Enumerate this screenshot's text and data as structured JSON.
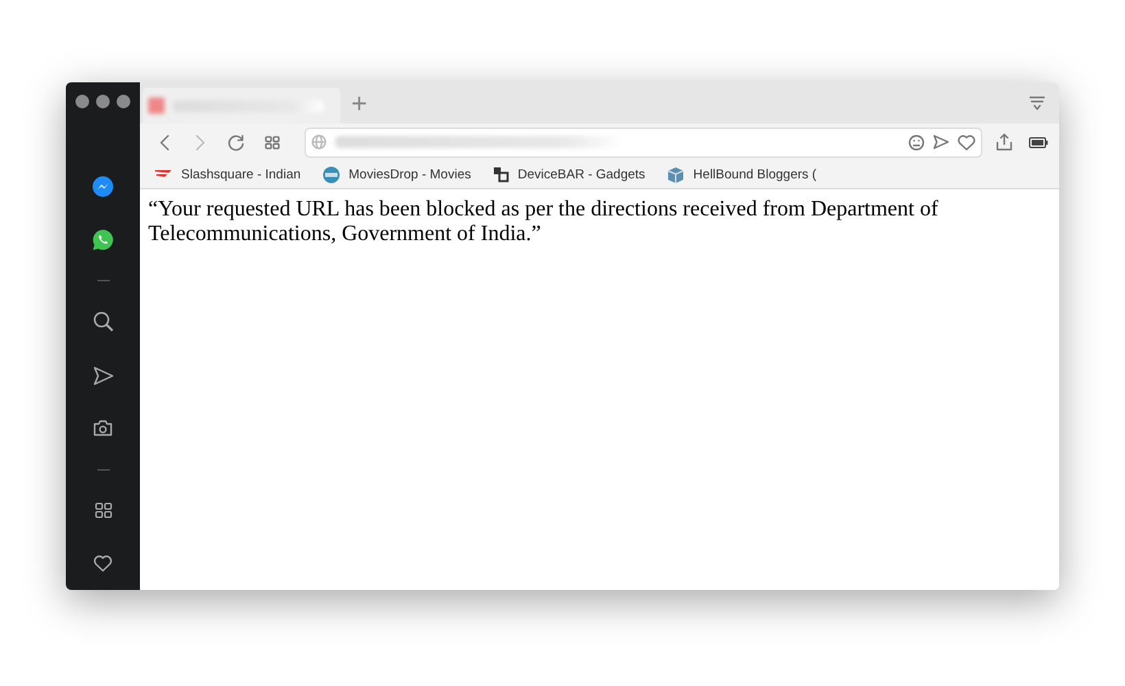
{
  "toolbar": {
    "new_tab": "+"
  },
  "bookmarks": [
    {
      "kind": "stripes",
      "label": "Slashsquare - Indian"
    },
    {
      "kind": "badge",
      "label": "MoviesDrop - Movies"
    },
    {
      "kind": "blocks",
      "label": "DeviceBAR - Gadgets"
    },
    {
      "kind": "cube",
      "label": "HellBound Bloggers ("
    }
  ],
  "page": {
    "message": "“Your requested URL has been blocked as per the directions received from Department of Telecommunications, Government of India.”"
  }
}
